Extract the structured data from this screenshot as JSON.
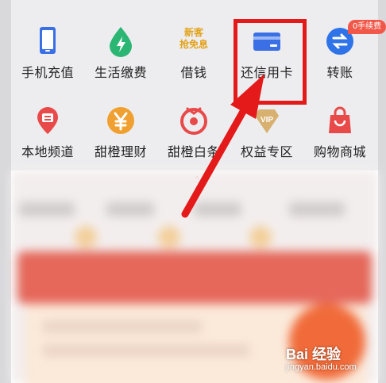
{
  "grid": {
    "items": [
      {
        "label": "手机充值",
        "icon": "phone-icon",
        "color": "#3a6fe6"
      },
      {
        "label": "生活缴费",
        "icon": "lightning-drop-icon",
        "color": "#2bb673"
      },
      {
        "label": "借钱",
        "icon": "promo-text-icon",
        "color": "#e3a21a",
        "promo_text": "新客\n抢免息"
      },
      {
        "label": "还信用卡",
        "icon": "credit-card-icon",
        "color": "#3a6fe6"
      },
      {
        "label": "转账",
        "icon": "transfer-icon",
        "color": "#2f73e8"
      },
      {
        "label": "本地频道",
        "icon": "location-pin-icon",
        "color": "#e84a4a"
      },
      {
        "label": "甜橙理财",
        "icon": "yen-coin-icon",
        "color": "#f0a030"
      },
      {
        "label": "甜橙白条",
        "icon": "orange-white-bar-icon",
        "color": "#e84a4a"
      },
      {
        "label": "权益专区",
        "icon": "vip-icon",
        "color": "#d8b070"
      },
      {
        "label": "购物商城",
        "icon": "shopping-bag-icon",
        "color": "#e84a4a"
      }
    ],
    "badge": "0手续费"
  },
  "watermark": {
    "main": "Bai 经验",
    "url": "jingyan.baidu.com"
  },
  "colors": {
    "highlight": "#e41a1a",
    "grid_bg": "#ededef"
  }
}
